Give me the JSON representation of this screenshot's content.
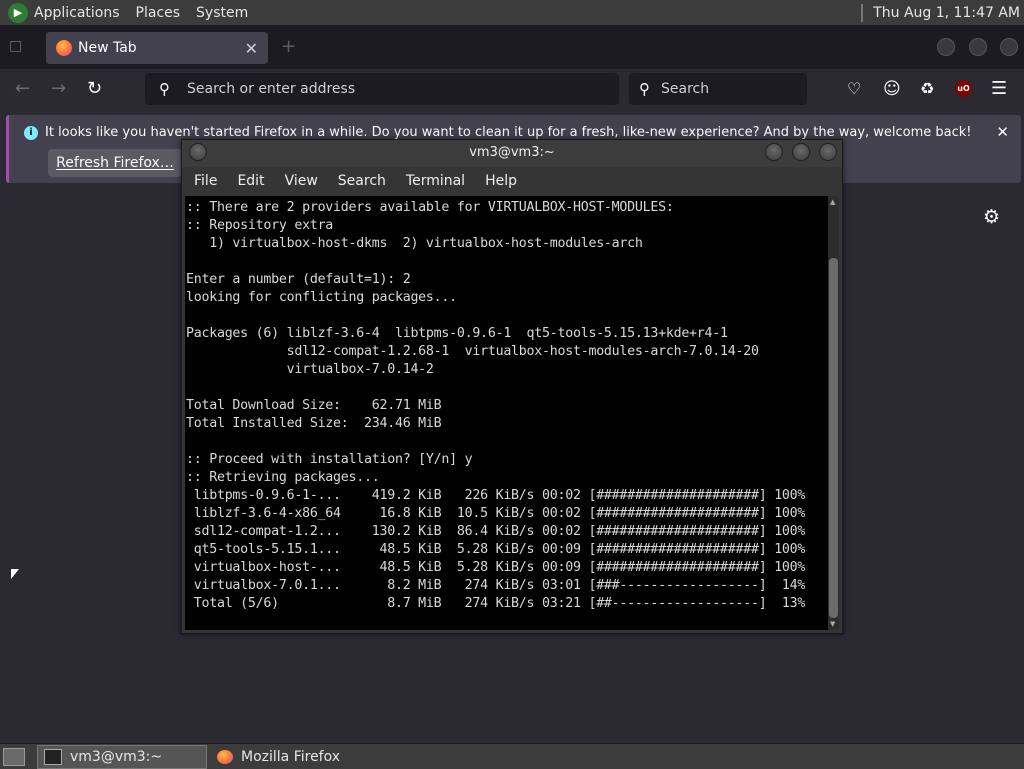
{
  "top_panel": {
    "menus": [
      "Applications",
      "Places",
      "System"
    ],
    "clock": "Thu Aug  1, 11:47 AM"
  },
  "firefox": {
    "tab": {
      "title": "New Tab"
    },
    "urlbar": {
      "placeholder": "Search or enter address"
    },
    "searchbar": {
      "placeholder": "Search"
    },
    "ublock_badge": "uO",
    "notification": {
      "message": "It looks like you haven't started Firefox in a while. Do you want to clean it up for a fresh, like-new experience? And by the way, welcome back!",
      "button": "Refresh Firefox…"
    }
  },
  "terminal": {
    "title": "vm3@vm3:~",
    "menu": [
      "File",
      "Edit",
      "View",
      "Search",
      "Terminal",
      "Help"
    ],
    "lines": [
      ":: There are 2 providers available for VIRTUALBOX-HOST-MODULES:",
      ":: Repository extra",
      "   1) virtualbox-host-dkms  2) virtualbox-host-modules-arch",
      "",
      "Enter a number (default=1): 2",
      "looking for conflicting packages...",
      "",
      "Packages (6) liblzf-3.6-4  libtpms-0.9.6-1  qt5-tools-5.15.13+kde+r4-1",
      "             sdl12-compat-1.2.68-1  virtualbox-host-modules-arch-7.0.14-20",
      "             virtualbox-7.0.14-2",
      "",
      "Total Download Size:    62.71 MiB",
      "Total Installed Size:  234.46 MiB",
      "",
      ":: Proceed with installation? [Y/n] y",
      ":: Retrieving packages...",
      " libtpms-0.9.6-1-...    419.2 KiB   226 KiB/s 00:02 [#####################] 100%",
      " liblzf-3.6-4-x86_64     16.8 KiB  10.5 KiB/s 00:02 [#####################] 100%",
      " sdl12-compat-1.2...    130.2 KiB  86.4 KiB/s 00:02 [#####################] 100%",
      " qt5-tools-5.15.1...     48.5 KiB  5.28 KiB/s 00:09 [#####################] 100%",
      " virtualbox-host-...     48.5 KiB  5.28 KiB/s 00:09 [#####################] 100%",
      " virtualbox-7.0.1...      8.2 MiB   274 KiB/s 03:01 [###------------------]  14%",
      " Total (5/6)              8.7 MiB   274 KiB/s 03:21 [##-------------------]  13%"
    ]
  },
  "taskbar": {
    "items": [
      "vm3@vm3:~",
      "Mozilla Firefox"
    ]
  }
}
